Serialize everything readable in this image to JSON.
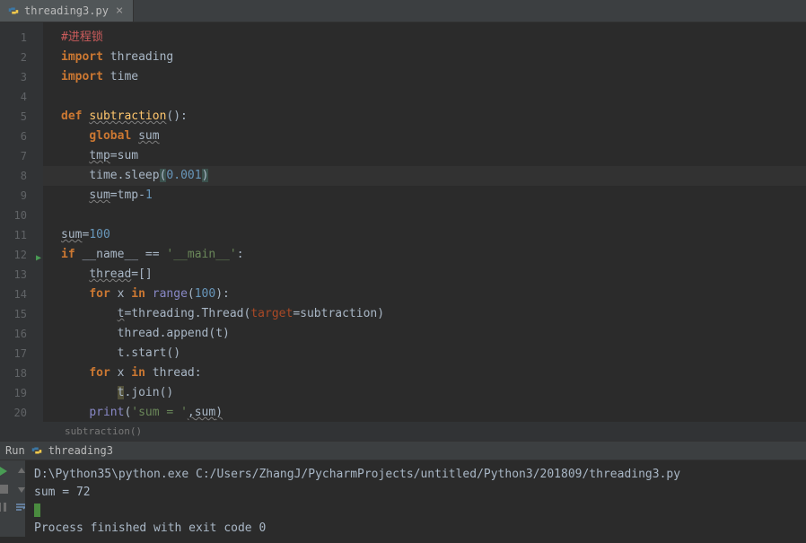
{
  "tab": {
    "name": "threading3.py",
    "icon": "python-icon"
  },
  "lines": [
    1,
    2,
    3,
    4,
    5,
    6,
    7,
    8,
    9,
    10,
    11,
    12,
    13,
    14,
    15,
    16,
    17,
    18,
    19,
    20
  ],
  "highlighted_line": 8,
  "run_marker_line": 12,
  "code": {
    "l1_comment": "#进程锁",
    "l2_import": "import",
    "l2_module": "threading",
    "l3_import": "import",
    "l3_module": "time",
    "l5_def": "def",
    "l5_func": "subtraction",
    "l5_parens": "():",
    "l6_global": "global",
    "l6_var": "sum",
    "l7_tmp": "tmp",
    "l7_eq": "=",
    "l7_sum": "sum",
    "l8_time": "time.sleep",
    "l8_lp": "(",
    "l8_num": "0.001",
    "l8_rp": ")",
    "l9_sum": "sum",
    "l9_eq1": "=",
    "l9_tmp": "tmp",
    "l9_minus": "-",
    "l9_one": "1",
    "l11_sum": "sum",
    "l11_eq": "=",
    "l11_num": "100",
    "l12_if": "if",
    "l12_name": "__name__ == ",
    "l12_main": "'__main__'",
    "l12_colon": ":",
    "l13_thread": "thread",
    "l13_eq": "=",
    "l13_list": "[]",
    "l14_for": "for",
    "l14_x": "x",
    "l14_in": "in",
    "l14_range": "range",
    "l14_lp": "(",
    "l14_num": "100",
    "l14_rp": "):",
    "l15_t": "t",
    "l15_eq": "=",
    "l15_thr": "threading.Thread(",
    "l15_target": "target",
    "l15_eq2": "=",
    "l15_sub": "subtraction",
    "l15_rp": ")",
    "l16_append": "thread.append(t)",
    "l17_start": "t.start()",
    "l18_for": "for",
    "l18_x": "x",
    "l18_in": "in",
    "l18_thread": "thread",
    "l18_colon": ":",
    "l19_t": "t",
    "l19_join": ".join()",
    "l20_print": "print",
    "l20_lp": "(",
    "l20_str": "'sum = '",
    "l20_comma": ",",
    "l20_sum": "sum",
    "l20_rp": ")"
  },
  "breadcrumb": "subtraction()",
  "run": {
    "label": "Run",
    "config": "threading3"
  },
  "console": {
    "line1": "D:\\Python35\\python.exe C:/Users/ZhangJ/PycharmProjects/untitled/Python3/201809/threading3.py",
    "line2": "sum =  72",
    "line4": "Process finished with exit code 0"
  }
}
